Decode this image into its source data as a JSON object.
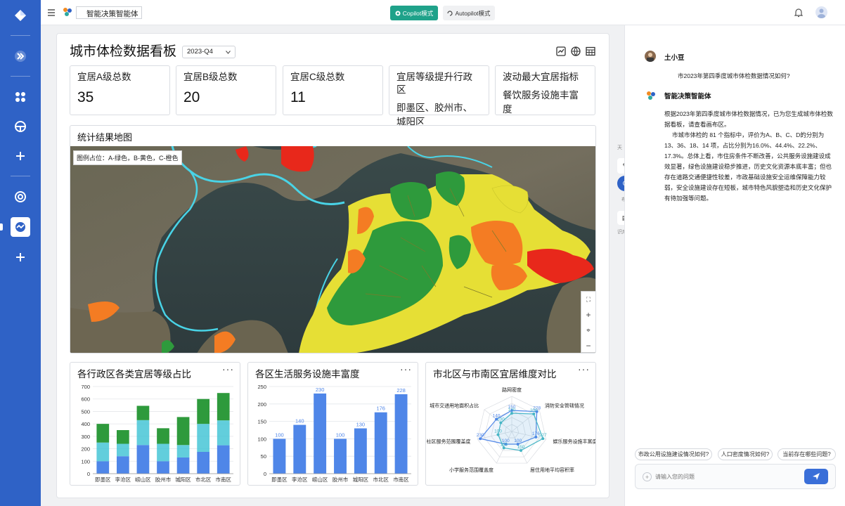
{
  "app": {
    "name": "智能决策智能体"
  },
  "modes": {
    "copilot": "Copilot模式",
    "autopilot": "Autopilot模式"
  },
  "dashboard": {
    "title": "城市体检数据看板",
    "period": "2023-Q4",
    "kpis": [
      {
        "label": "宜居A级总数",
        "value": "35"
      },
      {
        "label": "宜居B级总数",
        "value": "20"
      },
      {
        "label": "宜居C级总数",
        "value": "11"
      },
      {
        "label": "宜居等级提升行政区",
        "value": "即墨区、胶州市、城阳区"
      },
      {
        "label": "波动最大宜居指标",
        "value": "餐饮服务设施丰富度"
      }
    ],
    "map": {
      "title": "统计结果地图",
      "legend": "图例占位：A-绿色，B-黄色，C-橙色"
    },
    "more": "···"
  },
  "colors": {
    "rail": "#2f62c6",
    "green": "#2e9a3c",
    "yellow": "#e6df35",
    "orange": "#f47c23",
    "red": "#e8281b",
    "teal": "#2a9a94",
    "bar": "#4f86e8",
    "cyan": "#47c6d6",
    "send": "#3a6fd8"
  },
  "chart_data": [
    {
      "type": "bar",
      "stacked": true,
      "title": "各行政区各类宜居等级占比",
      "categories": [
        "即墨区",
        "李沧区",
        "崂山区",
        "胶州市",
        "城阳区",
        "市北区",
        "市南区"
      ],
      "ylim": [
        0,
        700
      ],
      "yticks": [
        0,
        100,
        200,
        300,
        400,
        500,
        600,
        700
      ],
      "series": [
        {
          "values": [
            100,
            140,
            230,
            100,
            130,
            175,
            228
          ]
        },
        {
          "values": [
            150,
            100,
            200,
            140,
            100,
            225,
            200
          ]
        },
        {
          "values": [
            150,
            110,
            115,
            125,
            225,
            200,
            220
          ]
        }
      ]
    },
    {
      "type": "bar",
      "title": "各区生活服务设施丰富度",
      "categories": [
        "即墨区",
        "李沧区",
        "崂山区",
        "胶州市",
        "城阳区",
        "市北区",
        "市南区"
      ],
      "values": [
        100,
        140,
        230,
        100,
        130,
        176,
        228
      ],
      "ylim": [
        0,
        250
      ],
      "yticks": [
        0,
        50,
        100,
        150,
        200,
        250
      ]
    },
    {
      "type": "radar",
      "title": "市北区与市南区宜居维度对比",
      "axes": [
        "路网密度",
        "消防安全管辖情况",
        "娱乐服务设施丰富度",
        "居住用地平均容积率",
        "小学服务范围覆盖度",
        "社区服务范围覆盖度",
        "城市交通用地面积占比"
      ],
      "max": 250,
      "series": [
        {
          "values": [
            150,
            228,
            176,
            100,
            100,
            230,
            140
          ]
        },
        {
          "values": [
            130,
            200,
            227,
            150,
            130,
            100,
            100
          ]
        }
      ]
    }
  ],
  "chat": {
    "user_name": "土小豆",
    "question": "市2023年第四季度城市体检数据情况如何?",
    "bot_name": "智能决策智能体",
    "p1": "根据2023年第四季度城市体检数据情况，已为您生成城市体检数据看板，请查看画布区。",
    "p2": "市城市体检的 81 个指标中，评价为A、B、C、D的分别为 13、36、18、14 项，占比分别为16.0%、44.4%、22.2%、17.3%。总体上看，市住房条件不断改善，公共服务设施建设成效显著，绿色设施建设稳步推进，历史文化资源本底丰富；但也存在道路交通便捷性较差，市政基础设施安全运维保障能力较弱，安全设施建设存在短板，城市特色风貌塑造和历史文化保护有待加强等问题。",
    "suggestions": [
      "市政公用设施建设情况如何?",
      "人口密度情况如何?",
      "当前存在哪些问题?"
    ],
    "input_placeholder": "请输入您的问题"
  },
  "side_tabs": [
    "天",
    "布",
    "识库"
  ]
}
